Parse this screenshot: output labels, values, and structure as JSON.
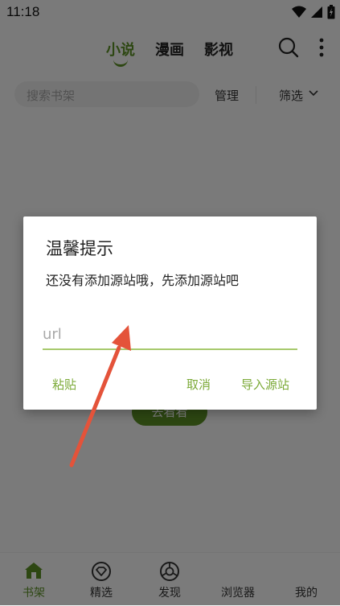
{
  "status_bar": {
    "time": "11:18",
    "icons": [
      "wifi-icon",
      "signal-icon",
      "battery-icon"
    ]
  },
  "header": {
    "tabs": [
      {
        "label": "小说",
        "active": true
      },
      {
        "label": "漫画",
        "active": false
      },
      {
        "label": "影视",
        "active": false
      }
    ],
    "icons": [
      "search-icon",
      "more-icon"
    ]
  },
  "toolbar": {
    "search_placeholder": "搜索书架",
    "manage_label": "管理",
    "filter_label": "筛选"
  },
  "empty_state": {
    "button_label": "去看看"
  },
  "bottom_nav": {
    "items": [
      {
        "label": "书架",
        "icon": "bookshelf-icon",
        "active": true
      },
      {
        "label": "精选",
        "icon": "featured-icon",
        "active": false
      },
      {
        "label": "发现",
        "icon": "discover-icon",
        "active": false
      },
      {
        "label": "浏览器",
        "icon": "",
        "active": false
      },
      {
        "label": "我的",
        "icon": "",
        "active": false
      }
    ]
  },
  "dialog": {
    "title": "温馨提示",
    "message": "还没有添加源站哦，先添加源站吧",
    "input_placeholder": "url",
    "input_value": "",
    "paste_label": "粘贴",
    "cancel_label": "取消",
    "import_label": "导入源站"
  },
  "colors": {
    "accent": "#5b8e24",
    "dialog_button": "#7caa38",
    "arrow": "#e4533a"
  }
}
